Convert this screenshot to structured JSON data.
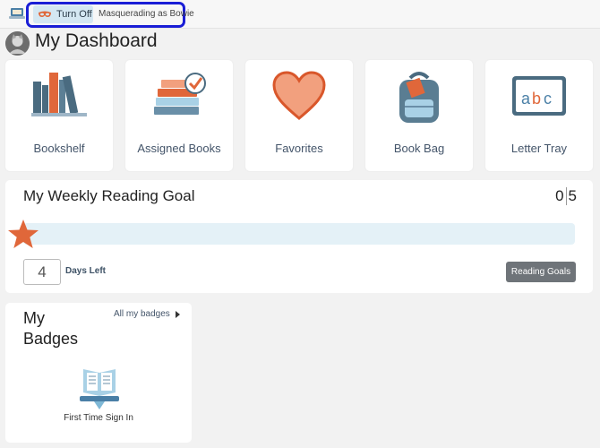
{
  "topbar": {
    "app_icon": "laptop-book-icon",
    "turn_off_label": "Turn Off",
    "masquerade_text": "Masquerading as Bowie",
    "highlight_color": "#1a1ed6"
  },
  "page": {
    "title": "My Dashboard",
    "avatar": "user-avatar"
  },
  "tiles": [
    {
      "label": "Bookshelf",
      "icon": "bookshelf-icon"
    },
    {
      "label": "Assigned Books",
      "icon": "assigned-books-icon"
    },
    {
      "label": "Favorites",
      "icon": "heart-icon"
    },
    {
      "label": "Book Bag",
      "icon": "backpack-icon"
    },
    {
      "label": "Letter Tray",
      "icon": "abc-tray-icon"
    }
  ],
  "goal": {
    "title": "My Weekly Reading Goal",
    "current": "0",
    "target": "5",
    "progress_fraction": 0,
    "days_left": "4",
    "days_label": "Days Left",
    "button_label": "Reading Goals"
  },
  "badges": {
    "title": "My Badges",
    "all_link": "All my badges",
    "items": [
      {
        "label": "First Time Sign In",
        "icon": "laptop-book-badge-icon"
      }
    ]
  },
  "colors": {
    "accent_orange": "#e0673a",
    "progress_track": "#e4f1f7",
    "button_gray": "#6f7479"
  }
}
